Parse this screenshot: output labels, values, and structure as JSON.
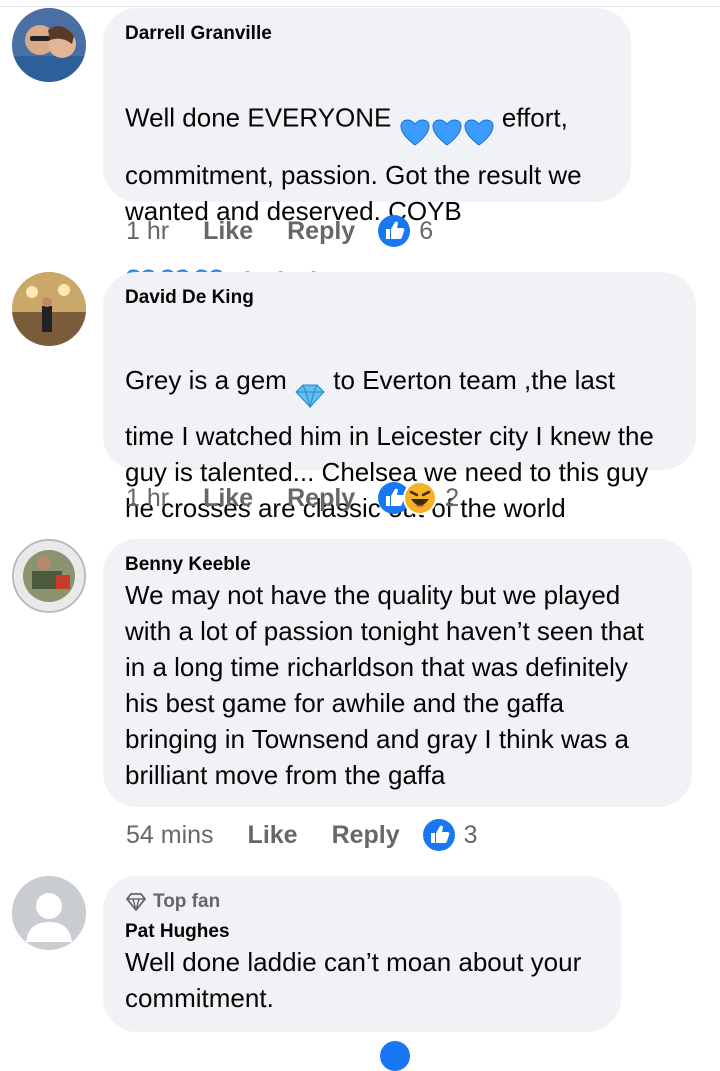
{
  "comments": [
    {
      "author": "Darrell Granville",
      "line1a": "Well done EVERYONE ",
      "line1b": " effort,",
      "rest": "commitment,  passion. Got the result we\nwanted and deserved. COYB",
      "time": "1 hr",
      "like": "Like",
      "reply": "Reply",
      "count": "6"
    },
    {
      "author": "David De King",
      "line1a": "Grey is a gem ",
      "line1b": " to Everton team ,the last",
      "rest": "time I watched him in Leicester city I knew the\nguy is talented... Chelsea we need to this guy\nhe crosses are classic out of the world",
      "time": "1 hr",
      "like": "Like",
      "reply": "Reply",
      "count": "2"
    },
    {
      "author": "Benny Keeble",
      "text": "We may not have the quality but we played\nwith a lot of passion tonight haven’t seen that\nin a long time richarldson that was definitely\nhis best game for awhile and the gaffa\nbringing in Townsend and gray I think was a\nbrilliant move from the gaffa",
      "time": "54 mins",
      "like": "Like",
      "reply": "Reply",
      "count": "3"
    },
    {
      "badge": "Top fan",
      "author": "Pat Hughes",
      "text": "Well done laddie can’t moan about your\ncommitment."
    }
  ],
  "icons": {
    "heart": "blue-heart-icon",
    "thumb": "thumbs-up-emoji-icon",
    "gem": "gem-icon",
    "like_reaction": "like-reaction-icon",
    "haha_reaction": "haha-reaction-icon",
    "top_fan": "diamond-badge-icon"
  },
  "colors": {
    "bubble": "#f0f2f5",
    "like_blue": "#1877f2",
    "meta_gray": "#65676b"
  }
}
